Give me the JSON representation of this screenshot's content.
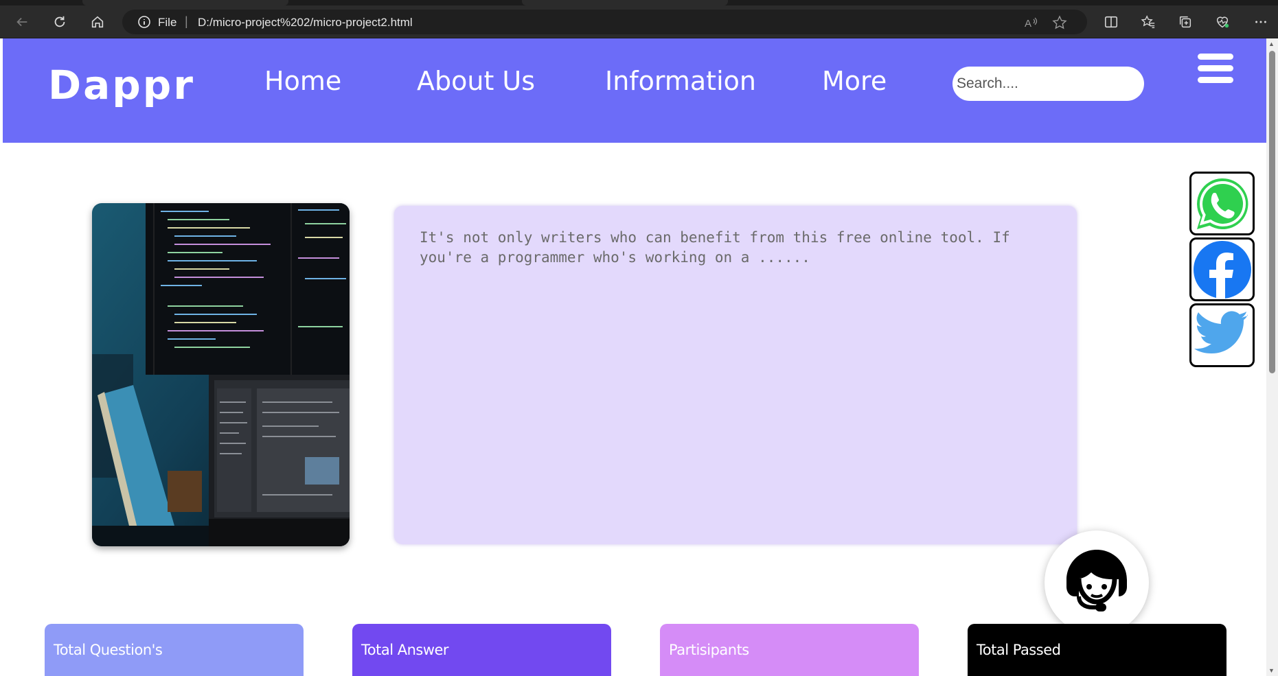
{
  "browser": {
    "address_file_label": "File",
    "address_separator": "|",
    "url": "D:/micro-project%202/micro-project2.html"
  },
  "nav": {
    "logo": "Dappr",
    "links": [
      "Home",
      "About Us",
      "Information",
      "More"
    ],
    "search_placeholder": "Search...."
  },
  "content": {
    "text": "It's not only writers who can benefit from this free online tool. If you're a programmer who's working on a ......"
  },
  "social": [
    "whatsapp-icon",
    "facebook-icon",
    "twitter-icon"
  ],
  "cards": [
    {
      "label": "Total Question's",
      "color": "#8f9bf7"
    },
    {
      "label": "Total Answer",
      "color": "#7249f0"
    },
    {
      "label": "Partisipants",
      "color": "#d58cf7"
    },
    {
      "label": "Total Passed",
      "color": "#000000"
    }
  ],
  "colors": {
    "nav_bg": "#6c6cf8",
    "textbox_bg": "#e3d9fc"
  }
}
